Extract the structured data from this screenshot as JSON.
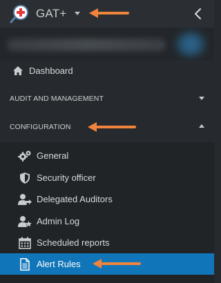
{
  "header": {
    "app_title": "GAT+"
  },
  "nav": {
    "dashboard_label": "Dashboard",
    "sections": [
      {
        "label": "AUDIT AND MANAGEMENT",
        "expanded": false
      },
      {
        "label": "CONFIGURATION",
        "expanded": true
      }
    ],
    "configuration_items": [
      {
        "label": "General",
        "icon": "gears-icon"
      },
      {
        "label": "Security officer",
        "icon": "shield-icon"
      },
      {
        "label": "Delegated Auditors",
        "icon": "user-share-icon"
      },
      {
        "label": "Admin Log",
        "icon": "user-star-icon"
      },
      {
        "label": "Scheduled reports",
        "icon": "calendar-icon"
      },
      {
        "label": "Alert Rules",
        "icon": "document-icon",
        "active": true
      }
    ]
  },
  "colors": {
    "background": "#262a2e",
    "submenu_background": "#202427",
    "active_item": "#1176b9",
    "annotation_arrow": "#f0843c",
    "logo_red": "#e23a3a"
  }
}
